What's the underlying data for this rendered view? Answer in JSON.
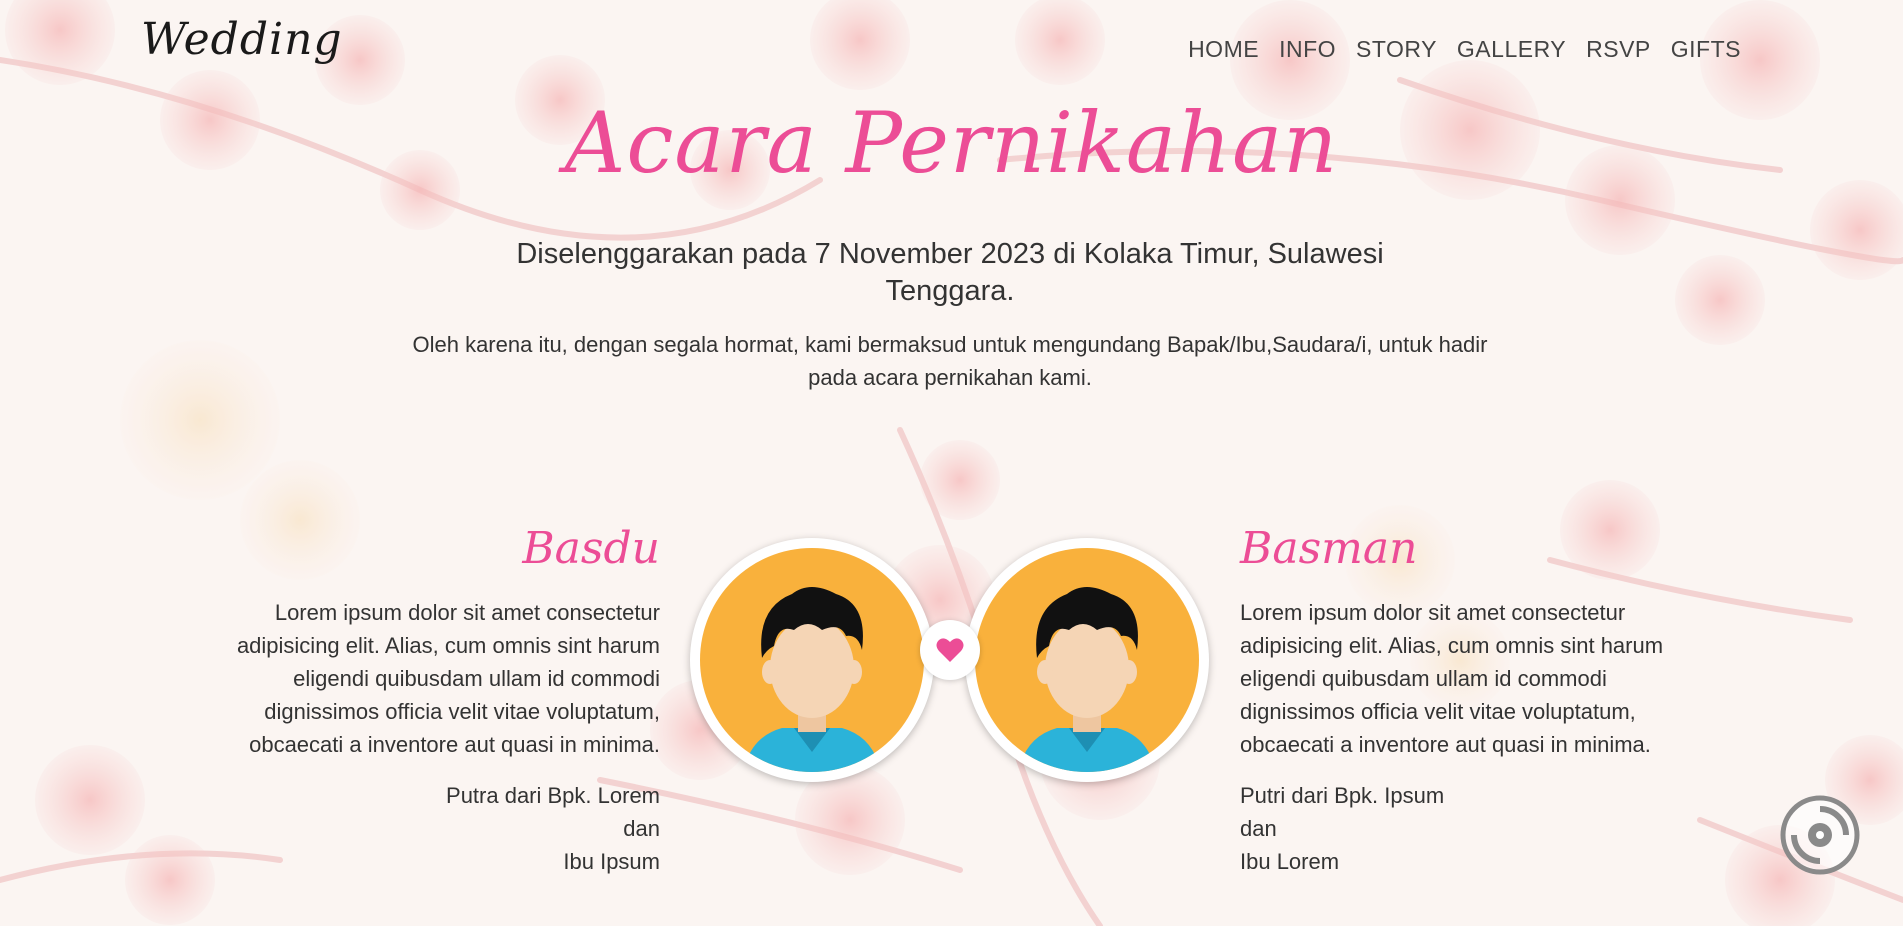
{
  "navbar": {
    "brand": "Wedding",
    "links": [
      "HOME",
      "INFO",
      "STORY",
      "GALLERY",
      "RSVP",
      "GIFTS"
    ]
  },
  "hero": {
    "title": "Acara Pernikahan",
    "subtitle": "Diselenggarakan pada 7 November 2023 di Kolaka Timur, Sulawesi Tenggara.",
    "note": "Oleh karena itu, dengan segala hormat, kami bermaksud untuk mengundang Bapak/Ibu,Saudara/i, untuk hadir pada acara pernikahan kami."
  },
  "groom": {
    "name": "Basdu",
    "description": "Lorem ipsum dolor sit amet consectetur adipisicing elit. Alias, cum omnis sint harum eligendi quibusdam ullam id commodi dignissimos officia velit vitae voluptatum, obcaecati a inventore aut quasi in minima.",
    "parents": [
      "Putra dari Bpk. Lorem",
      "dan",
      "Ibu Ipsum"
    ]
  },
  "bride": {
    "name": "Basman",
    "description": "Lorem ipsum dolor sit amet consectetur adipisicing elit. Alias, cum omnis sint harum eligendi quibusdam ullam id commodi dignissimos officia velit vitae voluptatum, obcaecati a inventore aut quasi in minima.",
    "parents": [
      "Putri dari Bpk. Ipsum",
      "dan",
      "Ibu Lorem"
    ]
  },
  "icons": {
    "heart": "heart-icon",
    "music": "music-toggle-icon"
  },
  "colors": {
    "accent": "#ec4d96",
    "avatar_bg": "#f9b13c",
    "shirt": "#2bb3d9",
    "skin": "#f5d5b5",
    "hair": "#111111",
    "blossom": "#f29a9a"
  }
}
